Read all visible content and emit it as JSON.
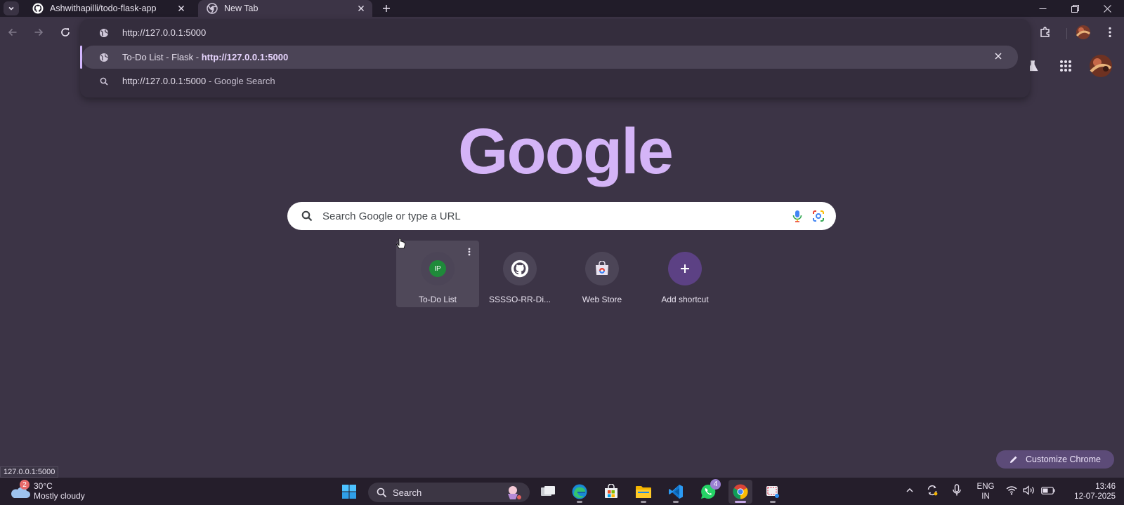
{
  "browser": {
    "tabs": [
      {
        "title": "Ashwithapilli/todo-flask-app",
        "icon": "github-icon",
        "active": false
      },
      {
        "title": "New Tab",
        "icon": "chrome-icon",
        "active": true
      }
    ],
    "new_tab_symbol": "+"
  },
  "omnibox": {
    "input_value": "http://127.0.0.1:5000",
    "suggestions": [
      {
        "title": "To-Do List - Flask - ",
        "url": "http://127.0.0.1:5000",
        "icon": "globe-icon"
      },
      {
        "query": "http://127.0.0.1:5000",
        "suffix": " - Google Search",
        "icon": "search-icon"
      }
    ]
  },
  "newtab": {
    "logo": "Google",
    "search_placeholder": "Search Google or type a URL",
    "shortcuts": [
      {
        "label": "To-Do List",
        "badge": "IP",
        "icon": "ip-badge-icon"
      },
      {
        "label": "SSSSO-RR-Di...",
        "icon": "github-icon"
      },
      {
        "label": "Web Store",
        "icon": "web-store-icon"
      },
      {
        "label": "Add shortcut",
        "icon": "plus-icon"
      }
    ],
    "customize_label": "Customize Chrome"
  },
  "status_bar": {
    "url": "127.0.0.1:5000"
  },
  "taskbar": {
    "weather": {
      "temp": "30°C",
      "condition": "Mostly cloudy",
      "badge": "2"
    },
    "search_label": "Search",
    "whatsapp_badge": "4",
    "lang_top": "ENG",
    "lang_bottom": "IN",
    "time": "13:46",
    "date": "12-07-2025"
  },
  "colors": {
    "page_bg": "#3c3446",
    "accent": "#d4b4f7",
    "titlebar": "#211c29",
    "taskbar": "#251e2b"
  }
}
